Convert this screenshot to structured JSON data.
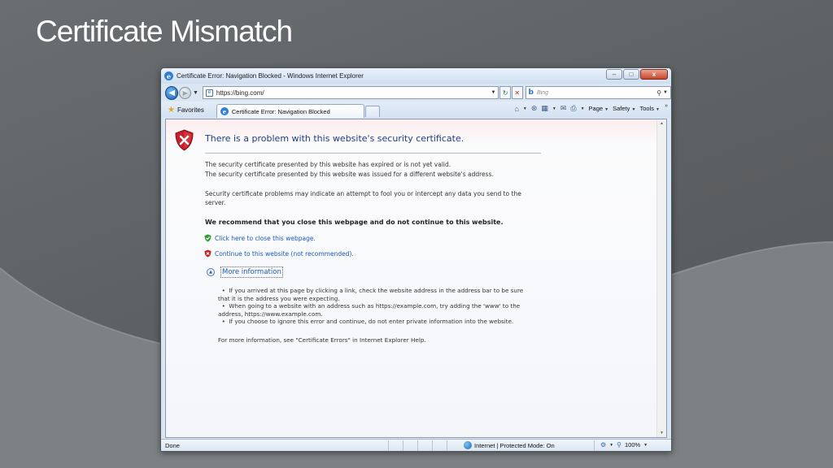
{
  "slide": {
    "title": "Certificate Mismatch"
  },
  "window": {
    "title": "Certificate Error: Navigation Blocked - Windows Internet Explorer",
    "controls": {
      "minimize": "–",
      "maximize": "□",
      "close": "x"
    }
  },
  "addressbar": {
    "url": "https://bing.com/",
    "search_engine": "b",
    "search_placeholder": "Bing"
  },
  "toolbar": {
    "favorites_label": "Favorites",
    "tab_label": "Certificate Error: Navigation Blocked",
    "page_label": "Page",
    "safety_label": "Safety",
    "tools_label": "Tools"
  },
  "content": {
    "heading": "There is a problem with this website's security certificate.",
    "line1": "The security certificate presented by this website has expired or is not yet valid.",
    "line2": "The security certificate presented by this website was issued for a different website's address.",
    "warning": "Security certificate problems may indicate an attempt to fool you or intercept any data you send to the server.",
    "recommend": "We recommend that you close this webpage and do not continue to this website.",
    "close_link": "Click here to close this webpage.",
    "continue_link": "Continue to this website (not recommended).",
    "more_info": "More information",
    "bullets": [
      "If you arrived at this page by clicking a link, check the website address in the address bar to be sure that it is the address you were expecting.",
      "When going to a website with an address such as https://example.com, try adding the 'www' to the address, https://www.example.com.",
      "If you choose to ignore this error and continue, do not enter private information into the website."
    ],
    "help": "For more information, see \"Certificate Errors\" in Internet Explorer Help."
  },
  "statusbar": {
    "status": "Done",
    "zone": "Internet | Protected Mode: On",
    "zoom": "100%"
  },
  "colors": {
    "link": "#1d59b6",
    "heading": "#1f3d83",
    "error_red": "#c8202a",
    "ok_green": "#3a9a3a"
  }
}
